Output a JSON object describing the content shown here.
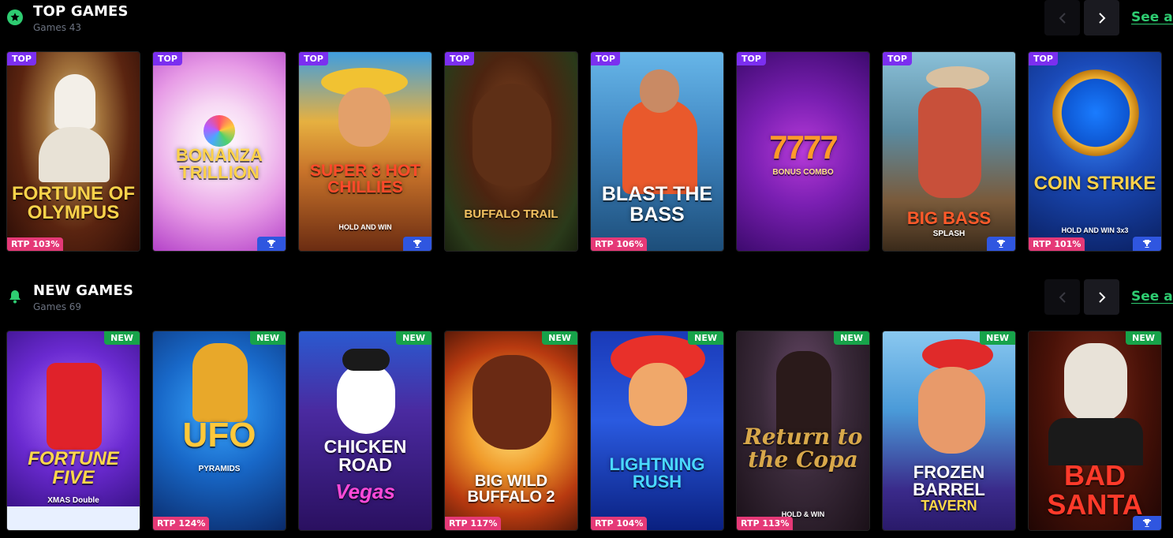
{
  "top_games": {
    "icon": "star-icon",
    "title": "TOP GAMES",
    "count": "Games 43",
    "see_all": "See all",
    "games": [
      {
        "name": "FORTUNE OF OLYMPUS",
        "tag": "TOP",
        "rtp": "RTP 103%",
        "trophy": false
      },
      {
        "name": "BONANZA TRILLION",
        "tag": "TOP",
        "rtp": "",
        "trophy": true
      },
      {
        "name": "SUPER 3 HOT CHILLIES",
        "sub": "HOLD AND WIN",
        "tag": "TOP",
        "rtp": "",
        "trophy": true
      },
      {
        "name": "BUFFALO TRAIL",
        "tag": "TOP",
        "rtp": "",
        "trophy": false
      },
      {
        "name": "BLAST THE BASS",
        "tag": "TOP",
        "rtp": "RTP 106%",
        "trophy": false
      },
      {
        "name": "7777",
        "sub": "BONUS COMBO",
        "tag": "TOP",
        "rtp": "",
        "trophy": false
      },
      {
        "name": "BIG BASS",
        "sub": "SPLASH",
        "tag": "TOP",
        "rtp": "",
        "trophy": true
      },
      {
        "name": "COIN STRIKE",
        "sub": "HOLD AND WIN 3x3",
        "tag": "TOP",
        "rtp": "RTP 101%",
        "trophy": true
      }
    ]
  },
  "new_games": {
    "icon": "bell-icon",
    "title": "NEW GAMES",
    "count": "Games 69",
    "see_all": "See all",
    "games": [
      {
        "name": "FORTUNE FIVE",
        "sub": "XMAS Double",
        "tag": "NEW",
        "rtp": "",
        "trophy": false
      },
      {
        "name": "UFO",
        "sub": "PYRAMIDS",
        "tag": "NEW",
        "rtp": "RTP 124%",
        "trophy": false
      },
      {
        "name": "CHICKEN ROAD",
        "sub": "Vegas",
        "tag": "NEW",
        "rtp": "",
        "trophy": false
      },
      {
        "name": "BIG WILD BUFFALO 2",
        "tag": "NEW",
        "rtp": "RTP 117%",
        "trophy": false
      },
      {
        "name": "LIGHTNING RUSH",
        "tag": "NEW",
        "rtp": "RTP 104%",
        "trophy": false
      },
      {
        "name": "Return to the Copa",
        "sub": "HOLD & WIN",
        "tag": "NEW",
        "rtp": "RTP 113%",
        "trophy": false
      },
      {
        "name": "FROZEN BARREL",
        "sub": "TAVERN",
        "tag": "NEW",
        "rtp": "",
        "trophy": false
      },
      {
        "name": "BAD SANTA",
        "tag": "NEW",
        "rtp": "",
        "trophy": true
      }
    ]
  },
  "colors": {
    "accent_green": "#2ecc71",
    "top_badge": "#7b2ff0",
    "new_badge": "#17a34a",
    "rtp_badge": "#e53977",
    "trophy_badge": "#2f56e0"
  }
}
